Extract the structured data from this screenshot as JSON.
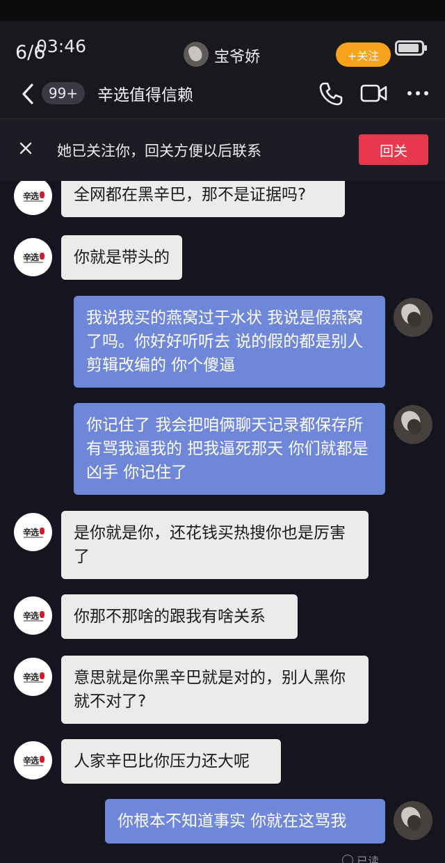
{
  "status": {
    "page_counter": "6/6",
    "clock": "03:46",
    "battery_level": 0.9
  },
  "contact_overlay": {
    "name": "宝爷娇",
    "follow_label": "+关注"
  },
  "header": {
    "unread_badge": "99+",
    "title": "辛选值得信赖",
    "back_icon": "chevron-left-icon",
    "phone_icon": "phone-icon",
    "video_icon": "video-camera-icon",
    "more_icon": "more-dots-icon"
  },
  "banner": {
    "text": "她已关注你，回关方便以后联系",
    "follow_back_label": "回关",
    "close_icon": "close-icon"
  },
  "messages": [
    {
      "side": "in",
      "text": "全网都在黑辛巴，那不是证据吗?"
    },
    {
      "side": "in",
      "text": "你就是带头的"
    },
    {
      "side": "out",
      "text": "我说我买的燕窝过于水状 我说是假燕窝了吗。你好好听听去 说的假的都是别人剪辑改编的 你个傻逼"
    },
    {
      "side": "out",
      "text": "你记住了 我会把咱俩聊天记录都保存所有骂我逼我的 把我逼死那天 你们就都是凶手 你记住了"
    },
    {
      "side": "in",
      "text": "是你就是你，还花钱买热搜你也是厉害了"
    },
    {
      "side": "in",
      "text": "你那不那啥的跟我有啥关系"
    },
    {
      "side": "in",
      "text": "意思就是你黑辛巴就是对的，别人黑你就不对了?"
    },
    {
      "side": "in",
      "text": "人家辛巴比你压力还大呢"
    },
    {
      "side": "out",
      "text": "你根本不知道事实 你就在这骂我"
    }
  ],
  "read_status": "已读",
  "colors": {
    "background": "#15151f",
    "incoming_bubble": "#ebebeb",
    "outgoing_bubble": "#6f87d9",
    "follow_orange": "#f7a21b",
    "follow_back_red": "#e9374e"
  }
}
